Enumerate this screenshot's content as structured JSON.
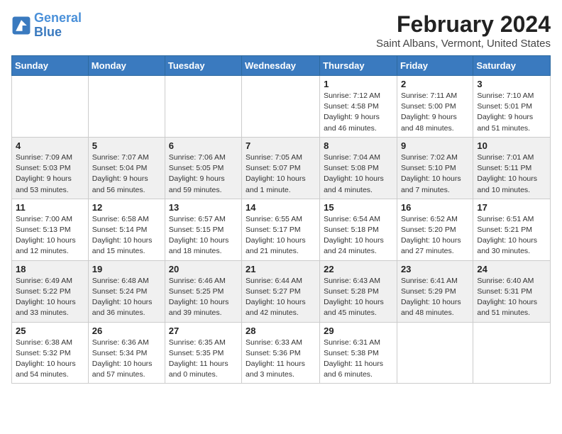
{
  "header": {
    "logo_line1": "General",
    "logo_line2": "Blue",
    "month": "February 2024",
    "location": "Saint Albans, Vermont, United States"
  },
  "weekdays": [
    "Sunday",
    "Monday",
    "Tuesday",
    "Wednesday",
    "Thursday",
    "Friday",
    "Saturday"
  ],
  "weeks": [
    [
      {
        "day": "",
        "info": ""
      },
      {
        "day": "",
        "info": ""
      },
      {
        "day": "",
        "info": ""
      },
      {
        "day": "",
        "info": ""
      },
      {
        "day": "1",
        "info": "Sunrise: 7:12 AM\nSunset: 4:58 PM\nDaylight: 9 hours and 46 minutes."
      },
      {
        "day": "2",
        "info": "Sunrise: 7:11 AM\nSunset: 5:00 PM\nDaylight: 9 hours and 48 minutes."
      },
      {
        "day": "3",
        "info": "Sunrise: 7:10 AM\nSunset: 5:01 PM\nDaylight: 9 hours and 51 minutes."
      }
    ],
    [
      {
        "day": "4",
        "info": "Sunrise: 7:09 AM\nSunset: 5:03 PM\nDaylight: 9 hours and 53 minutes."
      },
      {
        "day": "5",
        "info": "Sunrise: 7:07 AM\nSunset: 5:04 PM\nDaylight: 9 hours and 56 minutes."
      },
      {
        "day": "6",
        "info": "Sunrise: 7:06 AM\nSunset: 5:05 PM\nDaylight: 9 hours and 59 minutes."
      },
      {
        "day": "7",
        "info": "Sunrise: 7:05 AM\nSunset: 5:07 PM\nDaylight: 10 hours and 1 minute."
      },
      {
        "day": "8",
        "info": "Sunrise: 7:04 AM\nSunset: 5:08 PM\nDaylight: 10 hours and 4 minutes."
      },
      {
        "day": "9",
        "info": "Sunrise: 7:02 AM\nSunset: 5:10 PM\nDaylight: 10 hours and 7 minutes."
      },
      {
        "day": "10",
        "info": "Sunrise: 7:01 AM\nSunset: 5:11 PM\nDaylight: 10 hours and 10 minutes."
      }
    ],
    [
      {
        "day": "11",
        "info": "Sunrise: 7:00 AM\nSunset: 5:13 PM\nDaylight: 10 hours and 12 minutes."
      },
      {
        "day": "12",
        "info": "Sunrise: 6:58 AM\nSunset: 5:14 PM\nDaylight: 10 hours and 15 minutes."
      },
      {
        "day": "13",
        "info": "Sunrise: 6:57 AM\nSunset: 5:15 PM\nDaylight: 10 hours and 18 minutes."
      },
      {
        "day": "14",
        "info": "Sunrise: 6:55 AM\nSunset: 5:17 PM\nDaylight: 10 hours and 21 minutes."
      },
      {
        "day": "15",
        "info": "Sunrise: 6:54 AM\nSunset: 5:18 PM\nDaylight: 10 hours and 24 minutes."
      },
      {
        "day": "16",
        "info": "Sunrise: 6:52 AM\nSunset: 5:20 PM\nDaylight: 10 hours and 27 minutes."
      },
      {
        "day": "17",
        "info": "Sunrise: 6:51 AM\nSunset: 5:21 PM\nDaylight: 10 hours and 30 minutes."
      }
    ],
    [
      {
        "day": "18",
        "info": "Sunrise: 6:49 AM\nSunset: 5:22 PM\nDaylight: 10 hours and 33 minutes."
      },
      {
        "day": "19",
        "info": "Sunrise: 6:48 AM\nSunset: 5:24 PM\nDaylight: 10 hours and 36 minutes."
      },
      {
        "day": "20",
        "info": "Sunrise: 6:46 AM\nSunset: 5:25 PM\nDaylight: 10 hours and 39 minutes."
      },
      {
        "day": "21",
        "info": "Sunrise: 6:44 AM\nSunset: 5:27 PM\nDaylight: 10 hours and 42 minutes."
      },
      {
        "day": "22",
        "info": "Sunrise: 6:43 AM\nSunset: 5:28 PM\nDaylight: 10 hours and 45 minutes."
      },
      {
        "day": "23",
        "info": "Sunrise: 6:41 AM\nSunset: 5:29 PM\nDaylight: 10 hours and 48 minutes."
      },
      {
        "day": "24",
        "info": "Sunrise: 6:40 AM\nSunset: 5:31 PM\nDaylight: 10 hours and 51 minutes."
      }
    ],
    [
      {
        "day": "25",
        "info": "Sunrise: 6:38 AM\nSunset: 5:32 PM\nDaylight: 10 hours and 54 minutes."
      },
      {
        "day": "26",
        "info": "Sunrise: 6:36 AM\nSunset: 5:34 PM\nDaylight: 10 hours and 57 minutes."
      },
      {
        "day": "27",
        "info": "Sunrise: 6:35 AM\nSunset: 5:35 PM\nDaylight: 11 hours and 0 minutes."
      },
      {
        "day": "28",
        "info": "Sunrise: 6:33 AM\nSunset: 5:36 PM\nDaylight: 11 hours and 3 minutes."
      },
      {
        "day": "29",
        "info": "Sunrise: 6:31 AM\nSunset: 5:38 PM\nDaylight: 11 hours and 6 minutes."
      },
      {
        "day": "",
        "info": ""
      },
      {
        "day": "",
        "info": ""
      }
    ]
  ]
}
